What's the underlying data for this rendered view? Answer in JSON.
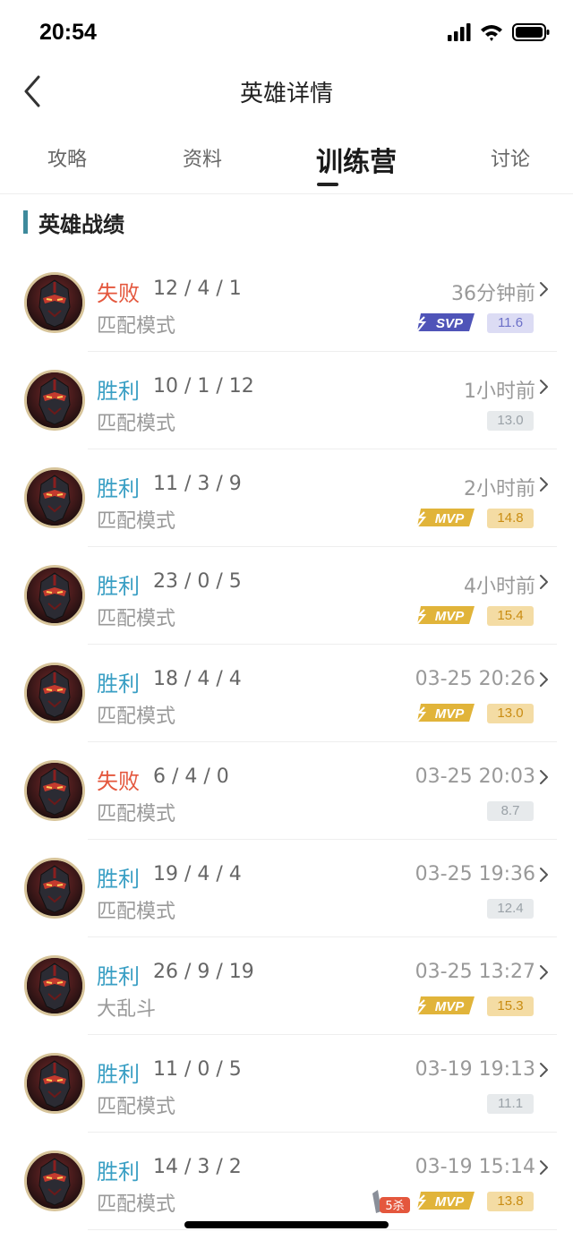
{
  "status_bar": {
    "time": "20:54"
  },
  "nav": {
    "title": "英雄详情"
  },
  "tabs": [
    {
      "label": "攻略",
      "active": false
    },
    {
      "label": "资料",
      "active": false
    },
    {
      "label": "训练营",
      "active": true
    },
    {
      "label": "讨论",
      "active": false
    }
  ],
  "section": {
    "title": "英雄战绩"
  },
  "badges": {
    "svp": "SVP",
    "mvp": "MVP",
    "kill": "5杀"
  },
  "matches": [
    {
      "result": "失败",
      "outcome": "lose",
      "kda": "12 / 4 / 1",
      "mode": "匹配模式",
      "time": "36分钟前",
      "score": "11.6",
      "badge": "svp",
      "multikill": ""
    },
    {
      "result": "胜利",
      "outcome": "win",
      "kda": "10 / 1 / 12",
      "mode": "匹配模式",
      "time": "1小时前",
      "score": "13.0",
      "badge": "",
      "multikill": ""
    },
    {
      "result": "胜利",
      "outcome": "win",
      "kda": "11 / 3 / 9",
      "mode": "匹配模式",
      "time": "2小时前",
      "score": "14.8",
      "badge": "mvp",
      "multikill": ""
    },
    {
      "result": "胜利",
      "outcome": "win",
      "kda": "23 / 0 / 5",
      "mode": "匹配模式",
      "time": "4小时前",
      "score": "15.4",
      "badge": "mvp",
      "multikill": ""
    },
    {
      "result": "胜利",
      "outcome": "win",
      "kda": "18 / 4 / 4",
      "mode": "匹配模式",
      "time": "03-25 20:26",
      "score": "13.0",
      "badge": "mvp",
      "multikill": ""
    },
    {
      "result": "失败",
      "outcome": "lose",
      "kda": "6 / 4 / 0",
      "mode": "匹配模式",
      "time": "03-25 20:03",
      "score": "8.7",
      "badge": "",
      "multikill": ""
    },
    {
      "result": "胜利",
      "outcome": "win",
      "kda": "19 / 4 / 4",
      "mode": "匹配模式",
      "time": "03-25 19:36",
      "score": "12.4",
      "badge": "",
      "multikill": ""
    },
    {
      "result": "胜利",
      "outcome": "win",
      "kda": "26 / 9 / 19",
      "mode": "大乱斗",
      "time": "03-25 13:27",
      "score": "15.3",
      "badge": "mvp",
      "multikill": ""
    },
    {
      "result": "胜利",
      "outcome": "win",
      "kda": "11 / 0 / 5",
      "mode": "匹配模式",
      "time": "03-19 19:13",
      "score": "11.1",
      "badge": "",
      "multikill": ""
    },
    {
      "result": "胜利",
      "outcome": "win",
      "kda": "14 / 3 / 2",
      "mode": "匹配模式",
      "time": "03-19 15:14",
      "score": "13.8",
      "badge": "mvp",
      "multikill": "5杀"
    }
  ],
  "colors": {
    "win": "#3a9fc4",
    "lose": "#e4573d",
    "accent_bar": "#3e8a9c",
    "mvp_gold": "#e1b43a",
    "svp_purple": "#4f54b8"
  },
  "icons": {
    "back": "back-chevron-icon",
    "row_chevron": "chevron-right-icon",
    "signal": "cellular-signal-icon",
    "wifi": "wifi-icon",
    "battery": "battery-icon",
    "avatar": "hero-avatar"
  }
}
